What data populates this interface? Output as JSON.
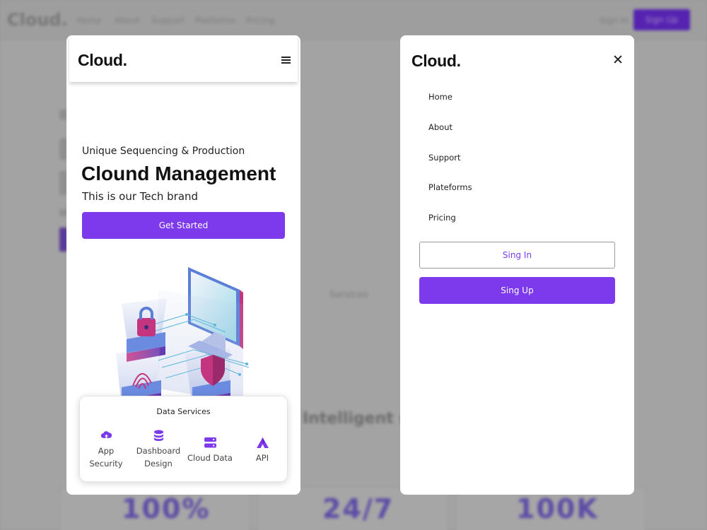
{
  "background": {
    "logo": "Cloud.",
    "nav_links": [
      "Home",
      "About",
      "Support",
      "Platforms",
      "Pricing"
    ],
    "signin_label": "Sign In",
    "signup_label": "Sign Up",
    "services_heading": "Services",
    "section_heading": "Intelligent service",
    "stats": [
      "100%",
      "24/7",
      "100K"
    ]
  },
  "mobile_home": {
    "logo": "Cloud.",
    "hero": {
      "eyebrow": "Unique Sequencing & Production",
      "title": "Clound Management",
      "subtitle": "This is our Tech brand",
      "cta_label": "Get Started"
    },
    "services": {
      "title": "Data Services",
      "items": [
        {
          "label_line1": "App",
          "label_line2": "Security",
          "icon": "cloud-upload-icon"
        },
        {
          "label_line1": "Dashboard",
          "label_line2": "Design",
          "icon": "database-icon"
        },
        {
          "label_line1": "Cloud Data",
          "label_line2": "",
          "icon": "server-icon"
        },
        {
          "label_line1": "API",
          "label_line2": "",
          "icon": "triangle-a-icon"
        }
      ]
    }
  },
  "mobile_menu": {
    "logo": "Cloud.",
    "items": [
      "Home",
      "About",
      "Support",
      "Plateforms",
      "Pricing"
    ],
    "signin_label": "Sing In",
    "signup_label": "Sing Up"
  },
  "colors": {
    "accent": "#7d3aed",
    "overlay": "#9b9b9b",
    "panel": "#ffffff"
  }
}
